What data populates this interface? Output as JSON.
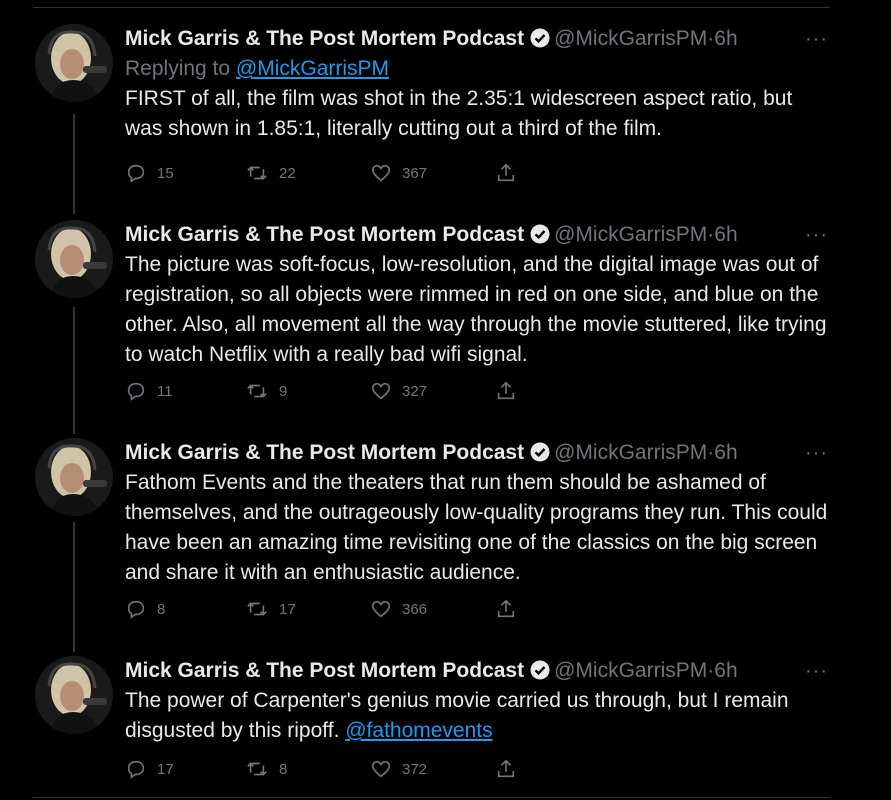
{
  "colors": {
    "background": "#000000",
    "text": "#e7e9ea",
    "muted": "#71767b",
    "link": "#1d9bf0"
  },
  "tweets": [
    {
      "name": "Mick Garris & The Post Mortem Podcast",
      "handle": "@MickGarrisPM",
      "dot": "·",
      "time": "6h",
      "more": "···",
      "replying_prefix": "Replying to ",
      "replying_to": "@MickGarrisPM",
      "text": "FIRST of all, the film was shot in the 2.35:1 widescreen aspect ratio, but was shown in 1.85:1, literally cutting out a third of the film.",
      "replies": "15",
      "retweets": "22",
      "likes": "367"
    },
    {
      "name": "Mick Garris & The Post Mortem Podcast",
      "handle": "@MickGarrisPM",
      "dot": "·",
      "time": "6h",
      "more": "···",
      "text": "The picture was soft-focus, low-resolution, and the digital image was out of registration, so all objects were rimmed in red on one side, and blue on the other. Also, all movement all the way through the movie stuttered, like trying to watch Netflix with a really bad wifi signal.",
      "replies": "11",
      "retweets": "9",
      "likes": "327"
    },
    {
      "name": "Mick Garris & The Post Mortem Podcast",
      "handle": "@MickGarrisPM",
      "dot": "·",
      "time": "6h",
      "more": "···",
      "text": "Fathom Events and the theaters that run them should be ashamed of themselves, and the outrageously low-quality programs they run. This could have been an amazing time revisiting one of the classics on the big screen and share it with an enthusiastic audience.",
      "replies": "8",
      "retweets": "17",
      "likes": "366"
    },
    {
      "name": "Mick Garris & The Post Mortem Podcast",
      "handle": "@MickGarrisPM",
      "dot": "·",
      "time": "6h",
      "more": "···",
      "text": "The power of Carpenter's genius movie carried us through, but I remain disgusted by this ripoff. ",
      "mention": "@fathomevents",
      "replies": "17",
      "retweets": "8",
      "likes": "372"
    }
  ]
}
